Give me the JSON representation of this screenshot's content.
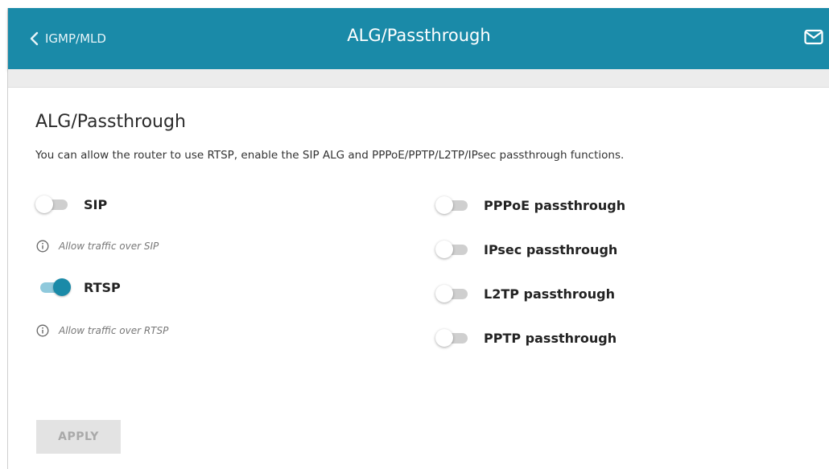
{
  "header": {
    "back_label": "IGMP/MLD",
    "title": "ALG/Passthrough",
    "mail_icon": "mail-icon"
  },
  "section": {
    "title": "ALG/Passthrough",
    "description": "You can allow the router to use RTSP, enable the SIP ALG and PPPoE/PPTP/L2TP/IPsec passthrough functions."
  },
  "left_toggles": [
    {
      "label": "SIP",
      "enabled": false,
      "hint": "Allow traffic over SIP"
    },
    {
      "label": "RTSP",
      "enabled": true,
      "hint": "Allow traffic over RTSP"
    }
  ],
  "right_toggles": [
    {
      "label": "PPPoE passthrough",
      "enabled": false
    },
    {
      "label": "IPsec passthrough",
      "enabled": false
    },
    {
      "label": "L2TP passthrough",
      "enabled": false
    },
    {
      "label": "PPTP passthrough",
      "enabled": false
    }
  ],
  "apply_label": "APPLY",
  "colors": {
    "header_bg": "#1a8aa8",
    "toggle_on": "#1a8aa8",
    "toggle_on_track": "#8fc9dc",
    "toggle_off_track": "#cfcfcf"
  }
}
